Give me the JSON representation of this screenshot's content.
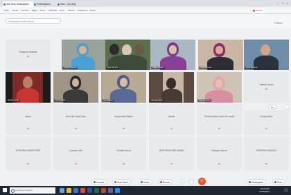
{
  "browser": {
    "tabs": [
      {
        "label": "Hari Guru Kebangsaan"
      },
      {
        "label": "Pembelajaran"
      },
      {
        "label": "Meet - abc-defg"
      }
    ],
    "bookmarks": [
      "Apps",
      "Gmail",
      "YouTube",
      "Maps",
      "Drive",
      "Calendar",
      "Docs",
      "Sheets",
      "Classroom",
      "News"
    ],
    "profile": "Paused"
  },
  "meeting": {
    "url_label": "meet.google.com/abc-defg-hij",
    "collapse_label": "Collapse"
  },
  "side_chip": {
    "label": "Pin"
  },
  "participants": {
    "row1_placeholder": {
      "name": "Pengurus Sekolah",
      "status": "mic off"
    },
    "row1_videos": [
      "Ustazah Rohani",
      "Puan Siti Nur",
      "Cikgu Aminah",
      "Cikgu Rosnah",
      "Encik Rahman"
    ],
    "row2_videos": [
      "Ahmad Faizal",
      "Siti Khadijah",
      "Nur Hidayah",
      "Fatimah Zahra",
      "Salmah Omar"
    ],
    "row2_placeholder": {
      "name": "Hafizah Ismail",
      "status": "mic off"
    },
    "row3": [
      {
        "name": "Musa",
        "status": "mic off"
      },
      {
        "name": "Nurul Ain Mohd Zain",
        "status": "mic off"
      },
      {
        "name": "Noraini Abd Rahim",
        "status": "mic off"
      },
      {
        "name": "Azizah",
        "status": "mic off"
      },
      {
        "name": "Mohd Khairul Anuar bin Ismail",
        "status": "mic off"
      },
      {
        "name": "Norsyuhada",
        "status": "mic off"
      }
    ],
    "row4": [
      {
        "name": "ROSLINDA MOHD ZAIN",
        "status": "mic off"
      },
      {
        "name": "Norazlin Jalil",
        "status": "mic off"
      },
      {
        "name": "Zaidatul Akma",
        "status": "mic off"
      },
      {
        "name": "NOR AZIAN ABD HAMID",
        "status": "mic off"
      },
      {
        "name": "Hidayah Ahmad",
        "status": "mic off"
      },
      {
        "name": "ROSNANI HASSAN",
        "status": "mic off"
      }
    ]
  },
  "toolbar": {
    "buttons": [
      "Unmute",
      "Start Video",
      "Share",
      "Record",
      "Reactions"
    ],
    "end_icon": "phone-hangup-icon",
    "right_buttons": [
      "Participants",
      "Chat"
    ]
  },
  "taskbar": {
    "search_placeholder": "Type here to search",
    "time": "10:24 AM",
    "date": "16/05/2021"
  },
  "colors": {
    "accent": "#5ec7c5",
    "end": "#e8542a",
    "muted": "#d33333"
  }
}
